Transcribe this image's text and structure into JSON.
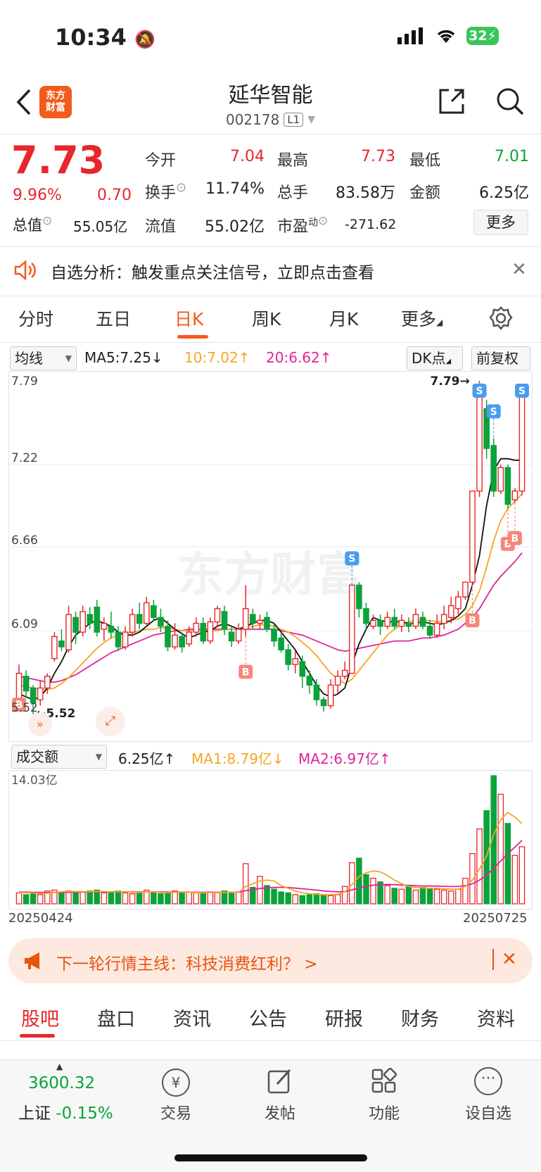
{
  "status": {
    "time": "10:34",
    "battery": "32"
  },
  "header": {
    "logo_line1": "东方",
    "logo_line2": "财富",
    "stock_name": "延华智能",
    "stock_code": "002178",
    "level_tag": "L1"
  },
  "quote": {
    "price": "7.73",
    "change_pct": "9.96%",
    "change": "0.70",
    "open_label": "今开",
    "open": "7.04",
    "high_label": "最高",
    "high": "7.73",
    "low_label": "最低",
    "low": "7.01",
    "turnover_label": "换手",
    "turnover": "11.74%",
    "volume_label": "总手",
    "volume": "83.58万",
    "amount_label": "金额",
    "amount": "6.25亿",
    "total_cap_label": "总值",
    "total_cap": "55.05亿",
    "float_cap_label": "流值",
    "float_cap": "55.02亿",
    "pe_label": "市盈",
    "pe_sup": "动",
    "pe": "-271.62",
    "more_label": "更多"
  },
  "alert": {
    "text": "自选分析：触发重点关注信号，立即点击查看"
  },
  "tabs": [
    "分时",
    "五日",
    "日K",
    "周K",
    "月K",
    "更多"
  ],
  "indicator": {
    "ma_select": "均线",
    "ma5": "MA5:7.25↓",
    "ma10": "10:7.02↑",
    "ma20": "20:6.62↑",
    "dk_label": "DK点",
    "adjust_label": "前复权"
  },
  "chart_data": [
    {
      "type": "candlestick",
      "y_ticks": [
        "7.79",
        "7.22",
        "6.66",
        "6.09",
        "5.52"
      ],
      "ylim": [
        5.52,
        7.79
      ],
      "high_marker": "7.79",
      "low_marker": "5.52",
      "watermark": "东方财富",
      "candles": [
        [
          5.62,
          5.8,
          5.86,
          5.55
        ],
        [
          5.78,
          5.68,
          5.82,
          5.63
        ],
        [
          5.7,
          5.6,
          5.72,
          5.52
        ],
        [
          5.62,
          5.7,
          5.75,
          5.58
        ],
        [
          5.7,
          5.78,
          5.8,
          5.66
        ],
        [
          5.9,
          6.05,
          6.08,
          5.88
        ],
        [
          6.02,
          5.98,
          6.1,
          5.95
        ],
        [
          5.96,
          6.2,
          6.26,
          5.94
        ],
        [
          6.18,
          6.08,
          6.22,
          6.0
        ],
        [
          6.08,
          6.22,
          6.26,
          6.05
        ],
        [
          6.2,
          6.14,
          6.25,
          6.1
        ],
        [
          6.25,
          6.08,
          6.3,
          6.05
        ],
        [
          6.1,
          6.14,
          6.18,
          6.02
        ],
        [
          6.12,
          6.08,
          6.22,
          6.04
        ],
        [
          6.08,
          5.98,
          6.12,
          5.95
        ],
        [
          5.98,
          6.08,
          6.12,
          5.96
        ],
        [
          6.08,
          6.2,
          6.24,
          6.05
        ],
        [
          6.2,
          6.14,
          6.28,
          6.1
        ],
        [
          6.14,
          6.28,
          6.32,
          6.12
        ],
        [
          6.26,
          6.18,
          6.3,
          6.15
        ],
        [
          6.18,
          6.12,
          6.24,
          6.08
        ],
        [
          6.12,
          5.98,
          6.16,
          5.95
        ],
        [
          5.98,
          6.06,
          6.14,
          5.96
        ],
        [
          6.05,
          5.98,
          6.08,
          5.94
        ],
        [
          6.0,
          6.08,
          6.12,
          5.98
        ],
        [
          6.08,
          6.14,
          6.18,
          6.05
        ],
        [
          6.14,
          6.02,
          6.18,
          6.0
        ],
        [
          6.02,
          6.15,
          6.18,
          6.0
        ],
        [
          6.15,
          6.24,
          6.26,
          6.12
        ],
        [
          6.22,
          6.1,
          6.26,
          6.06
        ],
        [
          6.08,
          6.02,
          6.12,
          5.98
        ],
        [
          6.02,
          6.1,
          6.14,
          6.0
        ],
        [
          6.1,
          6.24,
          6.4,
          6.05
        ],
        [
          6.2,
          6.14,
          6.24,
          6.1
        ],
        [
          6.14,
          6.16,
          6.2,
          6.1
        ],
        [
          6.18,
          6.1,
          6.22,
          6.08
        ],
        [
          6.1,
          6.02,
          6.14,
          5.98
        ],
        [
          6.04,
          5.96,
          6.08,
          5.94
        ],
        [
          5.96,
          5.86,
          6.0,
          5.82
        ],
        [
          5.86,
          5.9,
          5.95,
          5.8
        ],
        [
          5.88,
          5.78,
          5.92,
          5.7
        ],
        [
          5.78,
          5.72,
          5.82,
          5.66
        ],
        [
          5.72,
          5.62,
          5.76,
          5.58
        ],
        [
          5.62,
          5.58,
          5.64,
          5.54
        ],
        [
          5.58,
          5.72,
          5.76,
          5.56
        ],
        [
          5.72,
          5.78,
          5.82,
          5.66
        ],
        [
          5.78,
          5.82,
          5.88,
          5.76
        ],
        [
          5.8,
          6.4,
          6.4,
          5.8
        ],
        [
          6.4,
          6.24,
          6.42,
          6.18
        ],
        [
          6.24,
          6.14,
          6.28,
          6.1
        ],
        [
          6.12,
          6.16,
          6.2,
          6.1
        ],
        [
          6.16,
          6.12,
          6.2,
          6.06
        ],
        [
          6.12,
          6.18,
          6.22,
          6.1
        ],
        [
          6.18,
          6.12,
          6.24,
          6.1
        ],
        [
          6.12,
          6.16,
          6.2,
          6.08
        ],
        [
          6.14,
          6.12,
          6.18,
          6.08
        ],
        [
          6.12,
          6.2,
          6.24,
          6.1
        ],
        [
          6.18,
          6.12,
          6.22,
          6.1
        ],
        [
          6.12,
          6.06,
          6.16,
          6.04
        ],
        [
          6.06,
          6.14,
          6.2,
          6.04
        ],
        [
          6.14,
          6.2,
          6.26,
          6.1
        ],
        [
          6.18,
          6.26,
          6.32,
          6.14
        ],
        [
          6.24,
          6.32,
          6.36,
          6.2
        ],
        [
          6.32,
          6.42,
          6.42,
          6.3
        ],
        [
          6.42,
          7.04,
          7.04,
          6.4
        ],
        [
          7.04,
          7.74,
          7.79,
          7.0
        ],
        [
          7.6,
          7.33,
          7.66,
          7.26
        ],
        [
          7.35,
          7.04,
          7.4,
          7.0
        ],
        [
          7.04,
          7.2,
          7.22,
          7.02
        ],
        [
          7.2,
          6.95,
          7.22,
          6.92
        ],
        [
          6.98,
          7.04,
          7.06,
          6.96
        ],
        [
          7.04,
          7.73,
          7.73,
          7.01
        ]
      ],
      "ma5": [
        5.66,
        5.64,
        5.62,
        5.64,
        5.7,
        5.8,
        5.88,
        5.98,
        6.06,
        6.1,
        6.14,
        6.16,
        6.14,
        6.12,
        6.08,
        6.06,
        6.06,
        6.08,
        6.12,
        6.16,
        6.18,
        6.14,
        6.1,
        6.07,
        6.04,
        6.06,
        6.08,
        6.09,
        6.12,
        6.14,
        6.12,
        6.1,
        6.12,
        6.14,
        6.16,
        6.16,
        6.14,
        6.08,
        6.02,
        5.96,
        5.88,
        5.8,
        5.72,
        5.66,
        5.64,
        5.66,
        5.7,
        5.86,
        6.0,
        6.1,
        6.18,
        6.16,
        6.15,
        6.15,
        6.15,
        6.14,
        6.14,
        6.15,
        6.14,
        6.13,
        6.14,
        6.16,
        6.19,
        6.24,
        6.4,
        6.6,
        6.94,
        7.18,
        7.26,
        7.26,
        7.25,
        7.25
      ],
      "ma10": [
        5.72,
        5.71,
        5.7,
        5.69,
        5.69,
        5.7,
        5.73,
        5.77,
        5.82,
        5.87,
        5.92,
        5.97,
        6.01,
        6.04,
        6.06,
        6.07,
        6.08,
        6.09,
        6.1,
        6.1,
        6.11,
        6.11,
        6.1,
        6.09,
        6.09,
        6.09,
        6.09,
        6.09,
        6.09,
        6.1,
        6.1,
        6.1,
        6.11,
        6.12,
        6.13,
        6.13,
        6.12,
        6.1,
        6.08,
        6.05,
        6.01,
        5.97,
        5.92,
        5.86,
        5.8,
        5.76,
        5.73,
        5.76,
        5.82,
        5.88,
        5.94,
        6.0,
        6.06,
        6.1,
        6.13,
        6.15,
        6.16,
        6.16,
        6.16,
        6.15,
        6.15,
        6.16,
        6.17,
        6.2,
        6.26,
        6.36,
        6.52,
        6.7,
        6.84,
        6.92,
        6.97,
        7.02
      ],
      "ma20": [
        5.78,
        5.77,
        5.76,
        5.75,
        5.74,
        5.74,
        5.75,
        5.77,
        5.79,
        5.82,
        5.85,
        5.88,
        5.91,
        5.94,
        5.96,
        5.98,
        6.0,
        6.02,
        6.04,
        6.06,
        6.07,
        6.08,
        6.09,
        6.09,
        6.1,
        6.1,
        6.1,
        6.1,
        6.1,
        6.1,
        6.1,
        6.1,
        6.1,
        6.1,
        6.1,
        6.1,
        6.1,
        6.09,
        6.08,
        6.07,
        6.06,
        6.04,
        6.02,
        6.0,
        5.98,
        5.96,
        5.95,
        5.96,
        5.97,
        5.98,
        5.99,
        6.0,
        6.01,
        6.02,
        6.02,
        6.02,
        6.03,
        6.04,
        6.04,
        6.05,
        6.06,
        6.08,
        6.1,
        6.14,
        6.18,
        6.24,
        6.32,
        6.4,
        6.46,
        6.51,
        6.56,
        6.62
      ],
      "signals": [
        {
          "i": 0,
          "type": "B"
        },
        {
          "i": 32,
          "type": "B"
        },
        {
          "i": 47,
          "type": "S"
        },
        {
          "i": 64,
          "type": "B"
        },
        {
          "i": 65,
          "type": "S"
        },
        {
          "i": 67,
          "type": "S"
        },
        {
          "i": 69,
          "type": "B"
        },
        {
          "i": 70,
          "type": "B"
        },
        {
          "i": 71,
          "type": "S"
        }
      ]
    },
    {
      "type": "bar",
      "title": "成交额",
      "current": "6.25亿↑",
      "ma1_label": "MA1:8.79亿↓",
      "ma2_label": "MA2:6.97亿↑",
      "y_max_label": "14.03亿",
      "ylim": [
        0,
        14.03
      ],
      "x_start": "20250424",
      "x_end": "20250725",
      "values": [
        1.2,
        1.0,
        1.1,
        1.0,
        1.4,
        1.5,
        1.3,
        1.4,
        1.2,
        1.3,
        1.4,
        1.5,
        1.2,
        1.3,
        1.4,
        1.2,
        1.1,
        1.3,
        1.5,
        1.2,
        1.1,
        1.2,
        1.4,
        1.2,
        1.3,
        1.2,
        1.1,
        1.3,
        1.2,
        1.4,
        1.2,
        1.3,
        4.4,
        1.8,
        3.0,
        2.0,
        1.6,
        1.3,
        1.2,
        1.0,
        0.9,
        1.0,
        1.1,
        1.0,
        0.9,
        1.0,
        1.9,
        4.5,
        5.0,
        3.2,
        2.8,
        2.4,
        2.0,
        1.7,
        1.6,
        1.9,
        1.5,
        1.8,
        1.7,
        1.6,
        1.5,
        1.4,
        1.6,
        2.8,
        5.5,
        8.2,
        10.2,
        14.03,
        12.0,
        8.8,
        5.3,
        6.25
      ],
      "ma1": [
        1.25,
        1.22,
        1.18,
        1.12,
        1.15,
        1.25,
        1.32,
        1.36,
        1.35,
        1.33,
        1.32,
        1.36,
        1.34,
        1.32,
        1.34,
        1.31,
        1.26,
        1.25,
        1.3,
        1.3,
        1.24,
        1.22,
        1.28,
        1.27,
        1.25,
        1.25,
        1.22,
        1.23,
        1.23,
        1.26,
        1.24,
        1.26,
        1.9,
        2.2,
        2.5,
        2.6,
        2.5,
        2.0,
        1.7,
        1.4,
        1.2,
        1.1,
        1.05,
        1.0,
        1.0,
        1.05,
        1.3,
        2.1,
        3.0,
        3.4,
        3.6,
        3.5,
        3.1,
        2.6,
        2.2,
        1.9,
        1.8,
        1.75,
        1.7,
        1.7,
        1.65,
        1.6,
        1.6,
        1.9,
        2.6,
        3.8,
        5.2,
        7.6,
        9.2,
        10.0,
        9.5,
        8.79
      ],
      "ma2": [
        1.3,
        1.28,
        1.26,
        1.24,
        1.23,
        1.23,
        1.24,
        1.26,
        1.27,
        1.28,
        1.29,
        1.3,
        1.3,
        1.3,
        1.31,
        1.31,
        1.3,
        1.3,
        1.3,
        1.31,
        1.3,
        1.29,
        1.29,
        1.29,
        1.28,
        1.28,
        1.27,
        1.27,
        1.27,
        1.27,
        1.26,
        1.26,
        1.45,
        1.55,
        1.68,
        1.76,
        1.8,
        1.8,
        1.78,
        1.72,
        1.65,
        1.58,
        1.5,
        1.42,
        1.35,
        1.32,
        1.34,
        1.52,
        1.74,
        1.92,
        2.04,
        2.1,
        2.12,
        2.1,
        2.06,
        2.02,
        1.98,
        1.96,
        1.95,
        1.94,
        1.92,
        1.9,
        1.9,
        1.98,
        2.2,
        2.6,
        3.1,
        3.9,
        4.7,
        5.5,
        6.2,
        6.97
      ]
    }
  ],
  "promo": {
    "text": "下一轮行情主线：科技消费红利？ >"
  },
  "bottom_tabs": [
    "股吧",
    "盘口",
    "资讯",
    "公告",
    "研报",
    "财务",
    "资料"
  ],
  "bottom_bar": {
    "index_value": "3600.32",
    "index_name": "上证",
    "index_change": "-0.15%",
    "trade": "交易",
    "post": "发帖",
    "functions": "功能",
    "watchlist": "设自选"
  },
  "colors": {
    "up": "#e8262b",
    "down": "#0aa33a",
    "ma5": "#111111",
    "ma10": "#f5a623",
    "ma20": "#e0249a",
    "accent": "#f25b1c"
  }
}
